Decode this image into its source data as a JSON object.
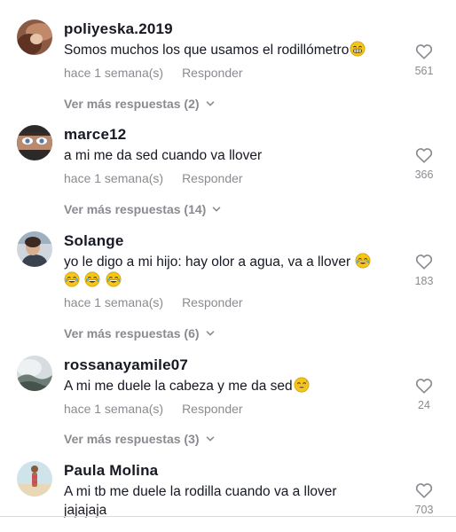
{
  "comments": [
    {
      "username": "poliyeska.2019",
      "text": "Somos muchos los que usamos el rodillómetro",
      "emoji": "grin-emoji",
      "time": "hace 1 semana(s)",
      "reply": "Responder",
      "likes": "561",
      "more": "Ver más respuestas (2)"
    },
    {
      "username": "marce12",
      "text": "a mi me da sed cuando va llover",
      "time": "hace 1 semana(s)",
      "reply": "Responder",
      "likes": "366",
      "more": "Ver más respuestas (14)"
    },
    {
      "username": "Solange",
      "text": "yo le digo a mi hijo: hay olor a agua, va a llover",
      "emoji": "tears-of-joy-emoji",
      "time": "hace 1 semana(s)",
      "reply": "Responder",
      "likes": "183",
      "more": "Ver más respuestas (6)"
    },
    {
      "username": "rossanayamile07",
      "text": "A mi me duele la cabeza y me da sed",
      "emoji": "sweat-smile-emoji",
      "time": "hace 1 semana(s)",
      "reply": "Responder",
      "likes": "24",
      "more": "Ver más respuestas (3)"
    },
    {
      "username": "Paula Molina",
      "text": "A mi tb me duele la rodilla cuando va a llover",
      "text2": "jajajaja",
      "likes": "703"
    }
  ],
  "colors": {
    "text": "#161823",
    "secondary": "#8a8b91",
    "emoji": "#f5c518"
  }
}
